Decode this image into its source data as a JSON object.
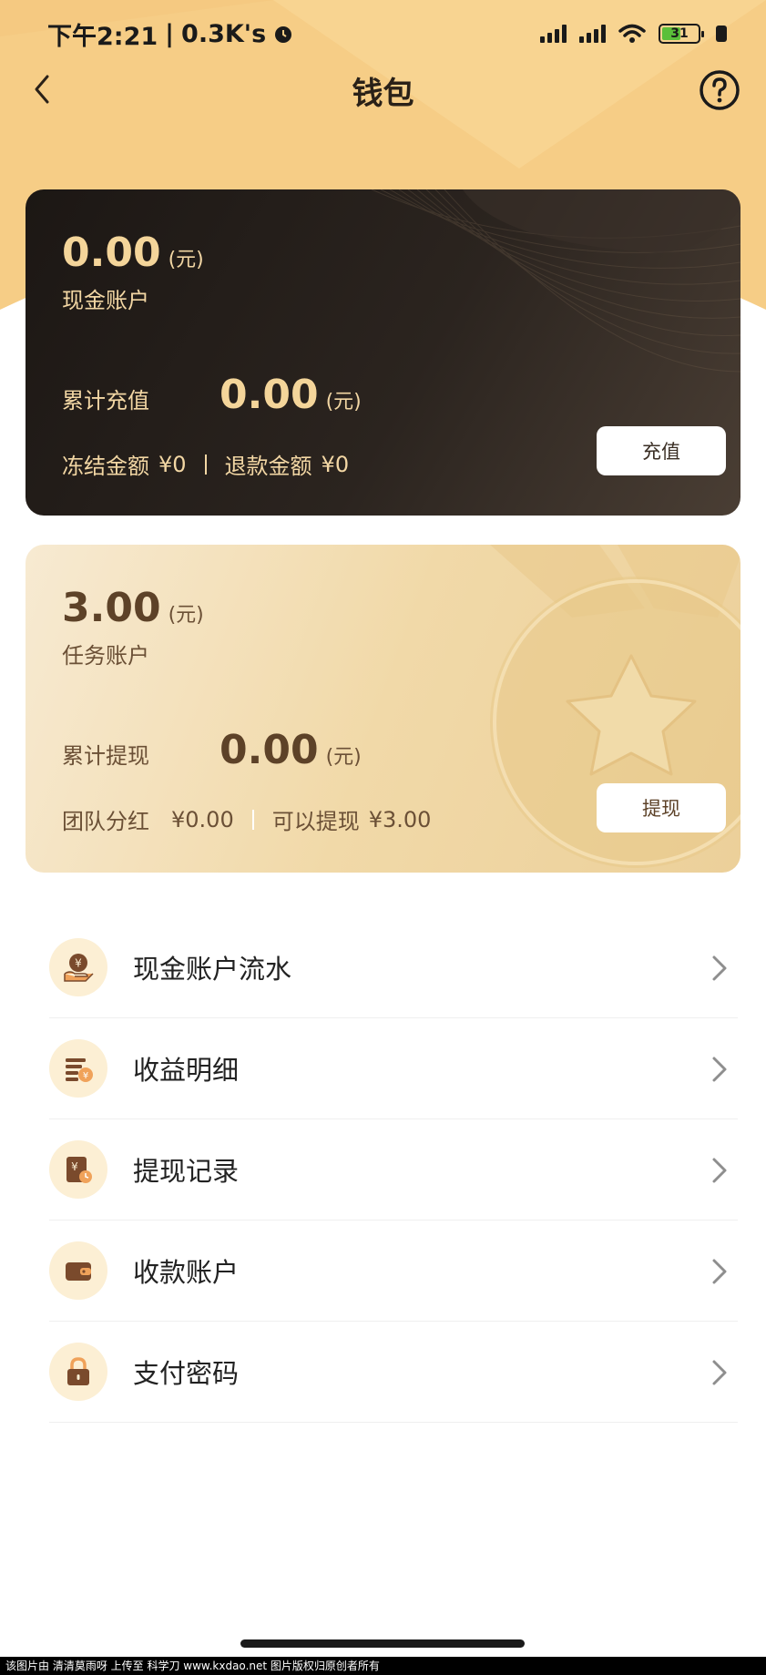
{
  "status_bar": {
    "time": "下午2:21",
    "network_speed": "0.3K's",
    "battery": "31",
    "alarm_icon": "alarm-clock-icon",
    "signal_icon": "cell-signal-icon",
    "wifi_icon": "wifi-icon"
  },
  "nav": {
    "title": "钱包",
    "back_icon": "chevron-left-icon",
    "help_icon": "question-circle-icon"
  },
  "cash_account": {
    "balance": "0.00",
    "unit": "(元)",
    "label": "现金账户",
    "total_label": "累计充值",
    "total_value": "0.00",
    "total_unit": "(元)",
    "frozen_label": "冻结金额",
    "frozen_value": "¥0",
    "refund_label": "退款金额",
    "refund_value": "¥0",
    "button": "充值"
  },
  "task_account": {
    "balance": "3.00",
    "unit": "(元)",
    "label": "任务账户",
    "total_label": "累计提现",
    "total_value": "0.00",
    "total_unit": "(元)",
    "dividend_label": "团队分红",
    "dividend_value": "¥0.00",
    "withdrawable_label": "可以提现",
    "withdrawable_value": "¥3.00",
    "button": "提现"
  },
  "menu": [
    {
      "label": "现金账户流水",
      "icon": "hand-yuan-icon"
    },
    {
      "label": "收益明细",
      "icon": "income-list-icon"
    },
    {
      "label": "提现记录",
      "icon": "withdraw-record-icon"
    },
    {
      "label": "收款账户",
      "icon": "wallet-icon"
    },
    {
      "label": "支付密码",
      "icon": "lock-icon"
    }
  ],
  "footer": "该图片由 清清莫雨呀 上传至 科学刀 www.kxdao.net 图片版权归原创者所有",
  "colors": {
    "hero": "#f6cd86",
    "dark_card": "#2b241f",
    "gold_card": "#f1d9a8",
    "gold_text": "#f4d59a",
    "brown_text": "#5d4228",
    "icon_bg": "#fcefd4"
  }
}
